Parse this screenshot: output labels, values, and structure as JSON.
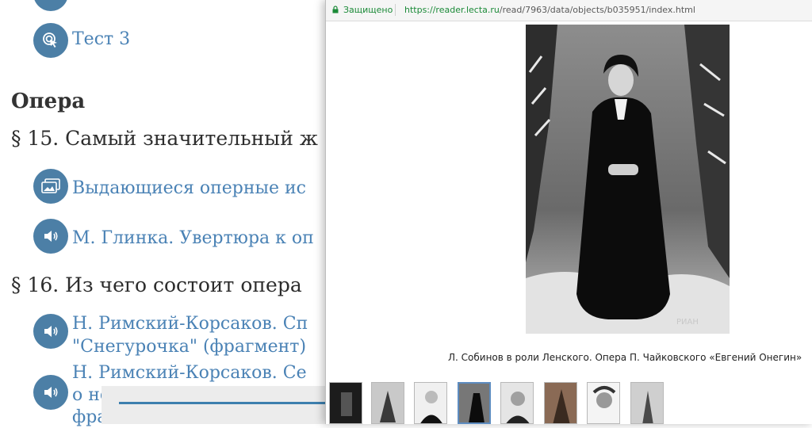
{
  "left_page": {
    "test_link": "Тест 3",
    "opera_heading": "Опера",
    "section15": "§ 15. Самый значительный ж",
    "link_singers": "Выдающиеся оперные ис",
    "link_glinka": "М. Глинка. Увертюра к оп",
    "section16": "§ 16. Из чего состоит опера",
    "link_rimsky1_line1": "Н. Римский-Корсаков. Сп",
    "link_rimsky1_line2": "\"Снегурочка\" (фрагмент)",
    "link_rimsky2_line1": "Н. Римский-Корсаков. Се",
    "link_rimsky2_line2": "о не",
    "link_rimsky2_line3": "фра"
  },
  "popup": {
    "secure_label": "Защищено",
    "url_host": "https://reader.lecta.ru",
    "url_path": "/read/7963/data/objects/b035951/index.html",
    "caption": "Л. Собинов в роли Ленского. Опера П. Чайковского «Евгений Онегин»",
    "watermark": "РИАН",
    "thumbnail_count": 8,
    "active_thumbnail": 4
  },
  "colors": {
    "accent": "#4c7fa6",
    "link": "#4a82b5",
    "secure_green": "#1b8a38"
  }
}
